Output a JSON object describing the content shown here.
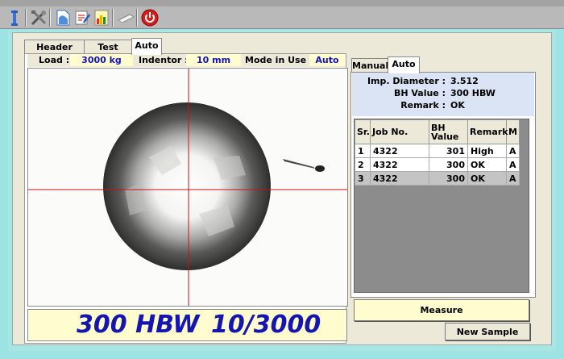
{
  "toolbar": {
    "icons": [
      "measure-tool-icon",
      "tools-icon",
      "new-document-icon",
      "edit-document-icon",
      "report-chart-icon",
      "eraser-icon",
      "power-icon"
    ],
    "power_color": "#d11f1f"
  },
  "tabs": [
    {
      "label": "Header Data",
      "active": false
    },
    {
      "label": "Test Data",
      "active": false
    },
    {
      "label": "Auto",
      "active": true
    }
  ],
  "info": {
    "load_label": "Load :",
    "load_value": "3000 kg",
    "indentor_label": "Indentor :",
    "indentor_value": "10 mm",
    "mode_label": "Mode in Use :",
    "mode_value": "Auto"
  },
  "result": {
    "hardness": "300 HBW",
    "scale": "10/3000"
  },
  "right_tabs": [
    {
      "label": "Manual",
      "active": false
    },
    {
      "label": "Auto",
      "active": true
    }
  ],
  "summary": {
    "diameter_label": "Imp. Diameter :",
    "diameter_value": "3.512",
    "bh_label": "BH Value :",
    "bh_value": "300 HBW",
    "remark_label": "Remark :",
    "remark_value": "OK"
  },
  "table": {
    "headers": [
      "Sr.",
      "Job No.",
      "BH Value",
      "Remark",
      "M"
    ],
    "rows": [
      [
        "1",
        "4322",
        "301",
        "High",
        "A"
      ],
      [
        "2",
        "4322",
        "300",
        "OK",
        "A"
      ],
      [
        "3",
        "4322",
        "300",
        "OK",
        "A"
      ]
    ],
    "selected_row": 2
  },
  "buttons": {
    "measure": "Measure",
    "new_sample": "New Sample"
  },
  "colors": {
    "accent_text": "#1313b8",
    "crosshair": "#cc1111",
    "highlight_bg": "#fffccf"
  }
}
